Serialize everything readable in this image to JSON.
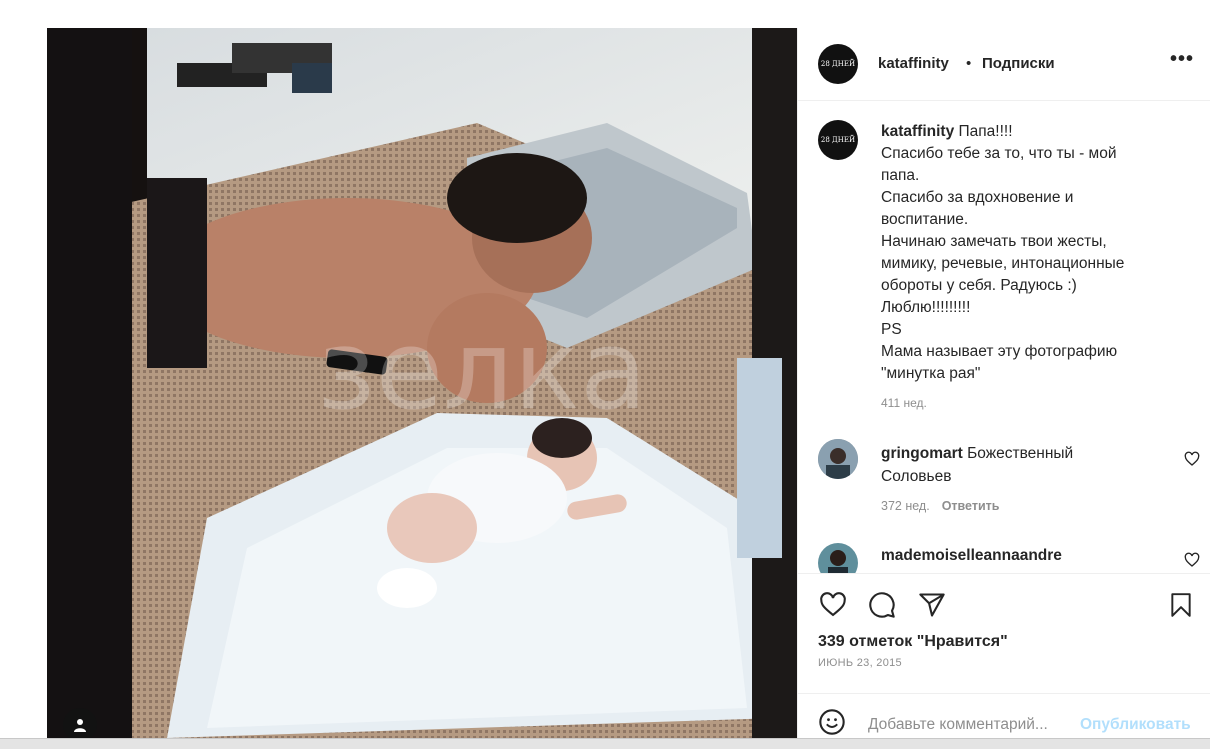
{
  "post": {
    "username": "kataffinity",
    "separator": "•",
    "follow_label": "Подписки",
    "more_label": "•••",
    "avatar_text": "28 ДНЕЙ",
    "watermark_text": "зелка"
  },
  "caption": {
    "username": "kataffinity",
    "lines": [
      "Папа!!!!",
      "Спасибо тебе за то, что ты - мой",
      "папа.",
      "Спасибо за вдохновение и",
      "воспитание.",
      "Начинаю замечать твои жесты,",
      "мимику, речевые, интонационные",
      "обороты у себя. Радуюсь :)",
      "Люблю!!!!!!!!!",
      "PS",
      "Мама называет эту фотографию",
      "\"минутка рая\""
    ],
    "time": "411 нед."
  },
  "comments": [
    {
      "username": "gringomart",
      "text_line1": "Божественный",
      "text_line2": "Соловьев",
      "time": "372 нед.",
      "reply_label": "Ответить"
    },
    {
      "username": "mademoiselleannaandre",
      "text_line1": ""
    }
  ],
  "actions": {
    "likes": "339 отметок \"Нравится\"",
    "date": "ИЮНЬ 23, 2015"
  },
  "add_comment": {
    "placeholder": "Добавьте комментарий...",
    "publish_label": "Опубликовать"
  },
  "colors": {
    "accent_disabled": "#b2dffc",
    "muted": "#8e8e8e",
    "text": "#262626"
  }
}
